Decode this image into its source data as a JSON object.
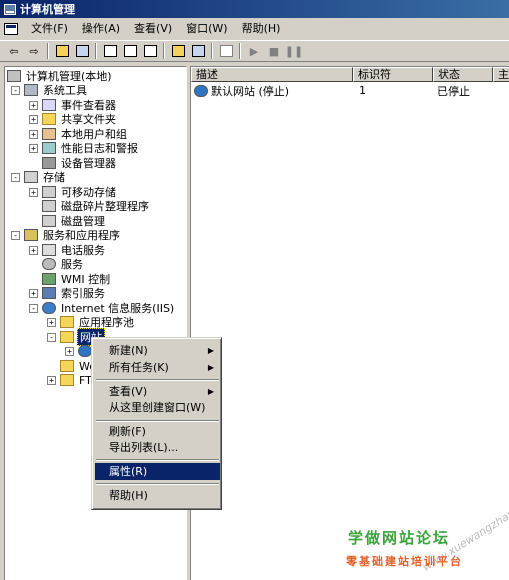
{
  "window": {
    "title": "计算机管理"
  },
  "menu": [
    "文件(F)",
    "操作(A)",
    "查看(V)",
    "窗口(W)",
    "帮助(H)"
  ],
  "toolbar": {
    "back": "⇦",
    "forward": "⇨",
    "play": "▶",
    "stop": "■",
    "pause": "❚❚"
  },
  "tree": {
    "root": "计算机管理(本地)",
    "system_tools": "系统工具",
    "event_viewer": "事件查看器",
    "shared_folders": "共享文件夹",
    "local_users": "本地用户和组",
    "perf_logs": "性能日志和警报",
    "device_manager": "设备管理器",
    "storage": "存储",
    "removable": "可移动存储",
    "defrag": "磁盘碎片整理程序",
    "disk_mgmt": "磁盘管理",
    "services_apps": "服务和应用程序",
    "telephony": "电话服务",
    "services": "服务",
    "wmi": "WMI 控制",
    "indexing": "索引服务",
    "iis": "Internet 信息服务(IIS)",
    "app_pools": "应用程序池",
    "websites": "网站",
    "web_ext": "We",
    "ftp": "FT"
  },
  "list": {
    "columns": [
      "描述",
      "标识符",
      "状态",
      "主"
    ],
    "rows": [
      {
        "description": "默认网站 (停止)",
        "id": "1",
        "status": "已停止"
      }
    ]
  },
  "context_menu": {
    "new": "新建(N)",
    "all_tasks": "所有任务(K)",
    "view": "查看(V)",
    "new_window": "从这里创建窗口(W)",
    "refresh": "刷新(F)",
    "export": "导出列表(L)...",
    "properties": "属性(R)",
    "help": "帮助(H)"
  },
  "watermark": {
    "line1": "学做网站论坛",
    "line2": "零基础建站培训平台",
    "url": "www.xuewangzhan.net"
  }
}
